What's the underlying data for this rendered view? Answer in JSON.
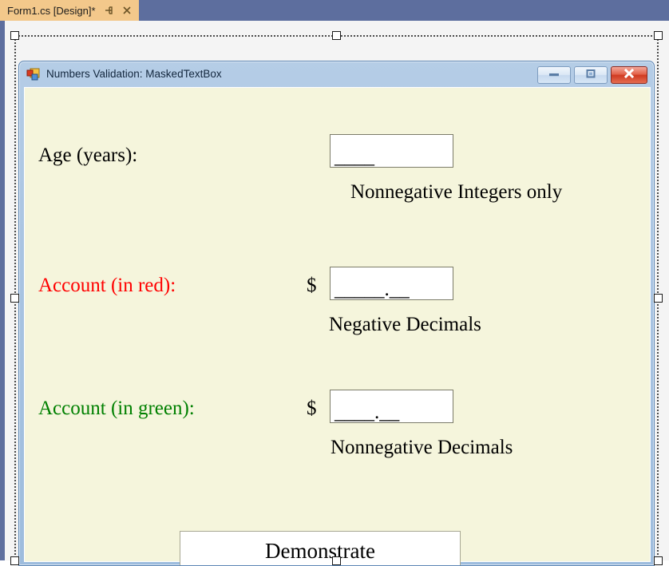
{
  "ide": {
    "tab": {
      "label": "Form1.cs [Design]*",
      "pin_icon": "pin-icon",
      "close_icon": "close-icon"
    }
  },
  "form": {
    "title": "Numbers Validation: MaskedTextBox",
    "icon": "app-form-icon",
    "background_color": "#f5f5dc",
    "caption_buttons": {
      "minimize": "minimize-icon",
      "maximize": "maximize-icon",
      "close": "close-icon"
    },
    "rows": [
      {
        "label": "Age (years):",
        "label_color": "#000000",
        "prefix": "",
        "mask_value": "____",
        "hint": "Nonnegative Integers only"
      },
      {
        "label": "Account (in red):",
        "label_color": "#ff0000",
        "prefix": "$",
        "mask_value": "_____.__",
        "hint": "Negative Decimals"
      },
      {
        "label": "Account (in green):",
        "label_color": "#008000",
        "prefix": "$",
        "mask_value": "____.__",
        "hint": "Nonnegative Decimals"
      }
    ],
    "button": {
      "label": "Demonstrate"
    }
  }
}
